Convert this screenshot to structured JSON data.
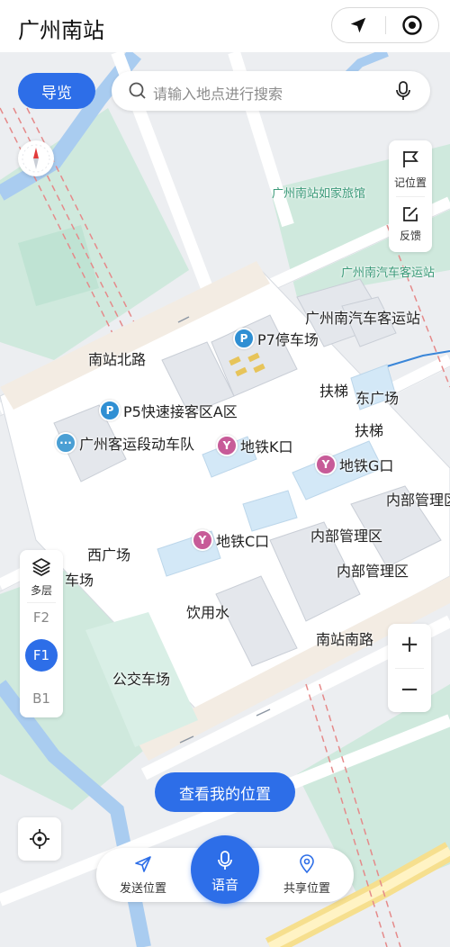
{
  "header": {
    "title": "广州南站"
  },
  "toolbar": {
    "guide_label": "导览",
    "search_placeholder": "请输入地点进行搜索"
  },
  "side_tools": {
    "mark_location": "记位置",
    "feedback": "反馈"
  },
  "floor_selector": {
    "multi_label": "多层",
    "floors": [
      "F2",
      "F1",
      "B1"
    ],
    "active_floor": "F1"
  },
  "actions": {
    "view_my_location": "查看我的位置",
    "send_location": "发送位置",
    "voice": "语音",
    "share_location": "共享位置"
  },
  "map": {
    "labels": {
      "hotel": "广州南站如家旅馆",
      "bus_station_green": "广州南汽车客运站",
      "bus_station": "广州南汽车客运站",
      "north_road": "南站北路",
      "p7": "P7停车场",
      "p5": "P5快速接客区A区",
      "motorcade": "广州客运段动车队",
      "escalator_1": "扶梯",
      "east_square": "东广场",
      "escalator_2": "扶梯",
      "metro_k": "地铁K口",
      "metro_g": "地铁G口",
      "metro_c": "地铁C口",
      "internal_mgmt_1": "内部管理区",
      "internal_mgmt_2": "内部管理区",
      "internal_mgmt_3": "内部管理区",
      "west_square": "西广场",
      "parking_lot": "车场",
      "drinking_water": "饮用水",
      "south_road": "南站南路",
      "bus_depot": "公交车场"
    }
  },
  "colors": {
    "accent": "#2d6ee8",
    "water": "#a9ccf0",
    "green_area": "#c7e7da",
    "station_floor": "#ffffff",
    "parking_icon": "#2f8fd3",
    "metro_icon": "#c75b98"
  }
}
